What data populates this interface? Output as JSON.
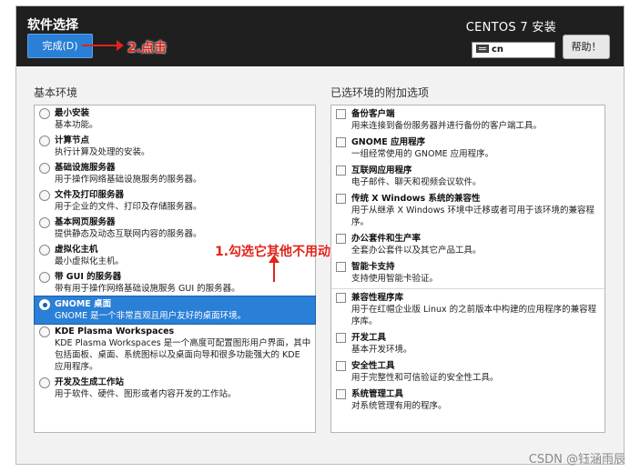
{
  "header": {
    "title": "软件选择",
    "product": "CENTOS 7 安装",
    "done_button": "完成(D)",
    "help_button": "帮助！",
    "keyboard_layout": "cn",
    "keyboard_icon": "keyboard-icon"
  },
  "annotations": {
    "step2": "2.点击",
    "step1": "1.勾选它其他不用动"
  },
  "base_env": {
    "heading": "基本环境",
    "selected_index": 7,
    "items": [
      {
        "name": "最小安装",
        "desc": "基本功能。"
      },
      {
        "name": "计算节点",
        "desc": "执行计算及处理的安装。"
      },
      {
        "name": "基础设施服务器",
        "desc": "用于操作网络基础设施服务的服务器。"
      },
      {
        "name": "文件及打印服务器",
        "desc": "用于企业的文件、打印及存储服务器。"
      },
      {
        "name": "基本网页服务器",
        "desc": "提供静态及动态互联网内容的服务器。"
      },
      {
        "name": "虚拟化主机",
        "desc": "最小虚拟化主机。"
      },
      {
        "name": "带 GUI 的服务器",
        "desc": "带有用于操作网络基础设施服务 GUI 的服务器。"
      },
      {
        "name": "GNOME 桌面",
        "desc": "GNOME 是一个非常直观且用户友好的桌面环境。"
      },
      {
        "name": "KDE Plasma Workspaces",
        "desc": "KDE Plasma Workspaces 是一个高度可配置图形用户界面，其中包括面板、桌面、系统图标以及桌面向导和很多功能强大的 KDE 应用程序。"
      },
      {
        "name": "开发及生成工作站",
        "desc": "用于软件、硬件、图形或者内容开发的工作站。"
      }
    ]
  },
  "addons": {
    "heading": "已选环境的附加选项",
    "items": [
      {
        "name": "备份客户端",
        "desc": "用来连接到备份服务器并进行备份的客户端工具。"
      },
      {
        "name": "GNOME 应用程序",
        "desc": "一组经常使用的 GNOME 应用程序。"
      },
      {
        "name": "互联网应用程序",
        "desc": "电子邮件、聊天和视频会议软件。"
      },
      {
        "name": "传统 X Windows 系统的兼容性",
        "desc": "用于从继承 X Windows 环境中迁移或者可用于该环境的兼容程序。"
      },
      {
        "name": "办公套件和生产率",
        "desc": "全套办公套件以及其它产品工具。"
      },
      {
        "name": "智能卡支持",
        "desc": "支持使用智能卡验证。"
      },
      {
        "name": "兼容性程序库",
        "desc": "用于在红帽企业版 Linux 的之前版本中构建的应用程序的兼容程序库。"
      },
      {
        "name": "开发工具",
        "desc": "基本开发环境。"
      },
      {
        "name": "安全性工具",
        "desc": "用于完整性和可信验证的安全性工具。"
      },
      {
        "name": "系统管理工具",
        "desc": "对系统管理有用的程序。"
      }
    ]
  },
  "watermark": "CSDN @钰涵雨辰"
}
